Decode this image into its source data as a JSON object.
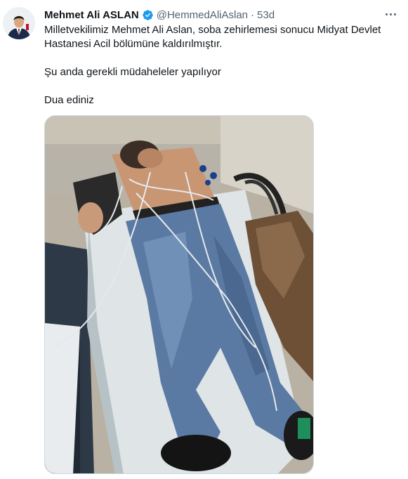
{
  "tweet": {
    "author_name": "Mehmet Ali ASLAN",
    "handle": "@HemmedAliAslan",
    "separator": "·",
    "time": "53d",
    "paragraphs": [
      "Milletvekilimiz Mehmet Ali Aslan, soba zehirlemesi sonucu Midyat Devlet Hastanesi Acil bölümüne kaldırılmıştır.",
      "Şu anda gerekli müdaheleler yapılıyor",
      "Dua ediniz"
    ]
  },
  "icons": {
    "verified": "verified-badge-icon",
    "more": "more-options-icon"
  },
  "colors": {
    "verified_blue": "#1d9bf0",
    "secondary_text": "#536471",
    "primary_text": "#0f1419"
  }
}
